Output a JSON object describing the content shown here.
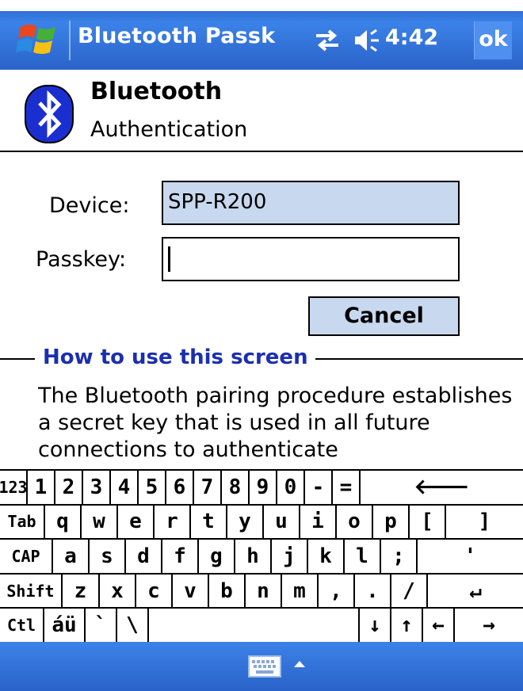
{
  "titlebar": {
    "app_title": "Bluetooth Passk",
    "clock": "4:42",
    "ok_label": "ok",
    "icons": [
      "windows-start-icon",
      "connectivity-icon",
      "volume-icon"
    ]
  },
  "header": {
    "title": "Bluetooth",
    "subtitle": "Authentication",
    "icon": "bluetooth-icon"
  },
  "form": {
    "device_label": "Device:",
    "device_value": "SPP-R200",
    "passkey_label": "Passkey:",
    "passkey_value": "",
    "cancel_label": "Cancel"
  },
  "howto": {
    "title": "How to use this screen",
    "text": "The Bluetooth pairing procedure establishes a secret key that is used in all future connections to authenticate"
  },
  "keyboard": {
    "rows": [
      [
        "123",
        "1",
        "2",
        "3",
        "4",
        "5",
        "6",
        "7",
        "8",
        "9",
        "0",
        "-",
        "=",
        "🡐"
      ],
      [
        "Tab",
        "q",
        "w",
        "e",
        "r",
        "t",
        "y",
        "u",
        "i",
        "o",
        "p",
        "[",
        "]"
      ],
      [
        "CAP",
        "a",
        "s",
        "d",
        "f",
        "g",
        "h",
        "j",
        "k",
        "l",
        ";",
        "'"
      ],
      [
        "Shift",
        "z",
        "x",
        "c",
        "v",
        "b",
        "n",
        "m",
        ",",
        ".",
        "/",
        "↵"
      ],
      [
        "Ctl",
        "áü",
        "`",
        "\\",
        "",
        "↓",
        "↑",
        "←",
        "→"
      ]
    ]
  },
  "colors": {
    "titlebar_blue": "#2f6fd6",
    "field_bg": "#c8d8ee",
    "howto_title": "#1b2fb0"
  }
}
